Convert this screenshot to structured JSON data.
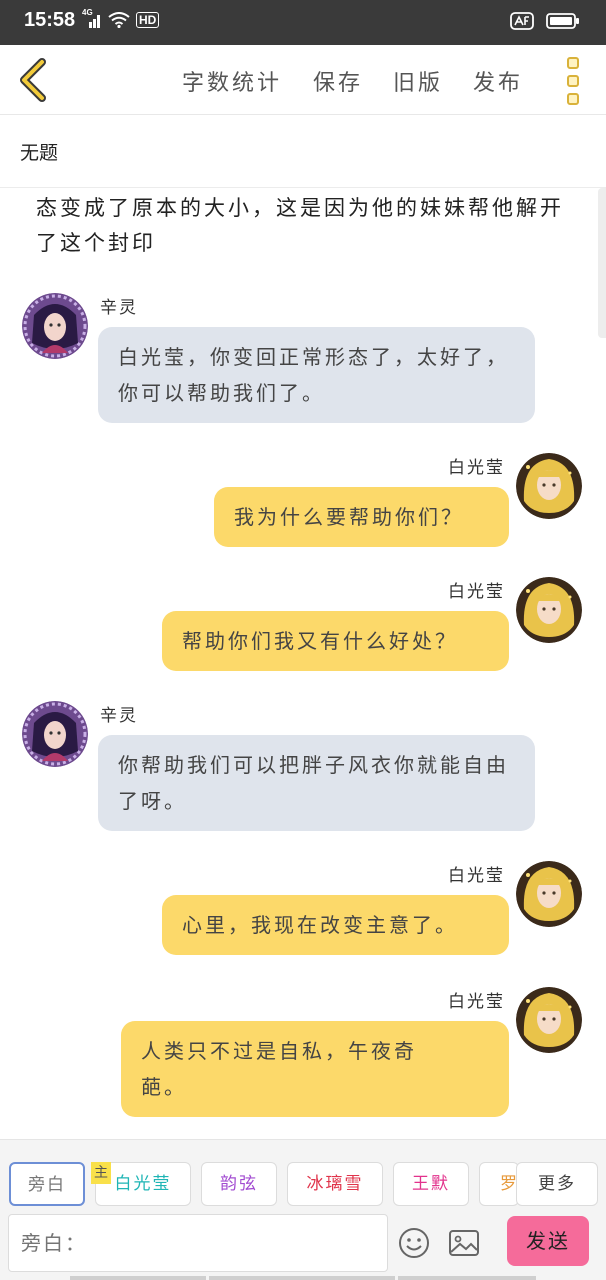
{
  "status_bar": {
    "time": "15:58",
    "network": "4G",
    "hd": "HD"
  },
  "header": {
    "actions": [
      "字数统计",
      "保存",
      "旧版",
      "发布"
    ]
  },
  "title": "无题",
  "narration": "态变成了原本的大小，这是因为他的妹妹帮他解开了这个封印",
  "messages": [
    {
      "side": "left",
      "name": "辛灵",
      "text": "白光莹，你变回正常形态了，太好了，你可以帮助我们了。"
    },
    {
      "side": "right",
      "name": "白光莹",
      "text": "我为什么要帮助你们？"
    },
    {
      "side": "right",
      "name": "白光莹",
      "text": "帮助你们我又有什么好处？"
    },
    {
      "side": "left",
      "name": "辛灵",
      "text": "你帮助我们可以把胖子风衣你就能自由了呀。"
    },
    {
      "side": "right",
      "name": "白光莹",
      "text": "心里，我现在改变主意了。"
    },
    {
      "side": "right",
      "name": "白光莹",
      "text": "人类只不过是自私，午夜奇葩。"
    }
  ],
  "characters": [
    {
      "label": "旁白",
      "color": "#777777"
    },
    {
      "label": "白光莹",
      "color": "#1fb5b5"
    },
    {
      "label": "韵弦",
      "color": "#a24bd1"
    },
    {
      "label": "冰璃雪",
      "color": "#e0344b"
    },
    {
      "label": "王默",
      "color": "#e2328c"
    },
    {
      "label": "罗",
      "color": "#e79a3c"
    }
  ],
  "main_badge": "主",
  "more_label": "更多",
  "input": {
    "placeholder": "旁白："
  },
  "send_label": "发送",
  "colors": {
    "left_bubble": "#dfe4ec",
    "right_bubble": "#fcd96a",
    "send": "#f56b9a"
  }
}
